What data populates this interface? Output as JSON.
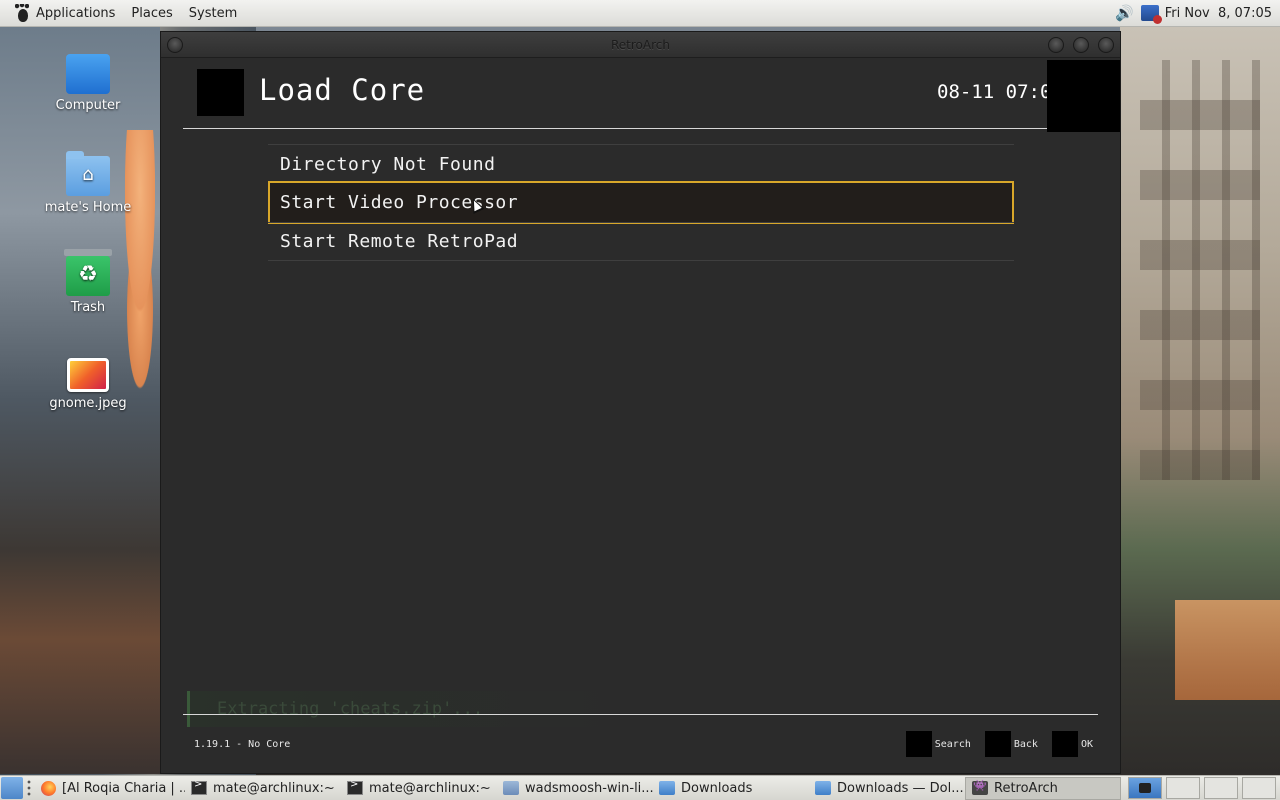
{
  "top_panel": {
    "menus": [
      "Applications",
      "Places",
      "System"
    ],
    "clock": "Fri Nov  8, 07:05",
    "icons": [
      "gnome-foot-icon",
      "volume-icon",
      "network-icon"
    ]
  },
  "desktop": {
    "icons": [
      {
        "label": "Computer",
        "icon": "computer-icon"
      },
      {
        "label": "mate's Home",
        "icon": "home-folder-icon"
      },
      {
        "label": "Trash",
        "icon": "trash-icon"
      },
      {
        "label": "gnome.jpeg",
        "icon": "image-file-icon"
      }
    ]
  },
  "window": {
    "title": "RetroArch",
    "controls": [
      "minimize-icon",
      "maximize-icon",
      "close-icon"
    ]
  },
  "retroarch": {
    "header_title": "Load Core",
    "clock": "08-11 07:05",
    "menu_items": [
      {
        "label": "Directory Not Found",
        "selected": false
      },
      {
        "label": "Start Video Processor",
        "selected": true
      },
      {
        "label": "Start Remote RetroPad",
        "selected": false
      }
    ],
    "notification": "Extracting 'cheats.zip'...",
    "version": "1.19.1 - No Core",
    "footer_buttons": [
      {
        "label": "Search"
      },
      {
        "label": "Back"
      },
      {
        "label": "OK"
      }
    ],
    "colors": {
      "selection_border": "#d8a72a",
      "background": "#2b2b2b",
      "text": "#f2f2f2"
    }
  },
  "taskbar": {
    "items": [
      {
        "label": "[Al Roqia Charia | ...",
        "icon": "firefox-icon",
        "active": false
      },
      {
        "label": "mate@archlinux:~",
        "icon": "terminal-icon",
        "active": false
      },
      {
        "label": "mate@archlinux:~",
        "icon": "terminal-icon",
        "active": false
      },
      {
        "label": "wadsmoosh-win-li...",
        "icon": "document-icon",
        "active": false
      },
      {
        "label": "Downloads",
        "icon": "folder-icon",
        "active": false
      },
      {
        "label": "Downloads — Dol...",
        "icon": "folder-icon",
        "active": false
      },
      {
        "label": "RetroArch",
        "icon": "retroarch-icon",
        "active": true
      }
    ]
  }
}
